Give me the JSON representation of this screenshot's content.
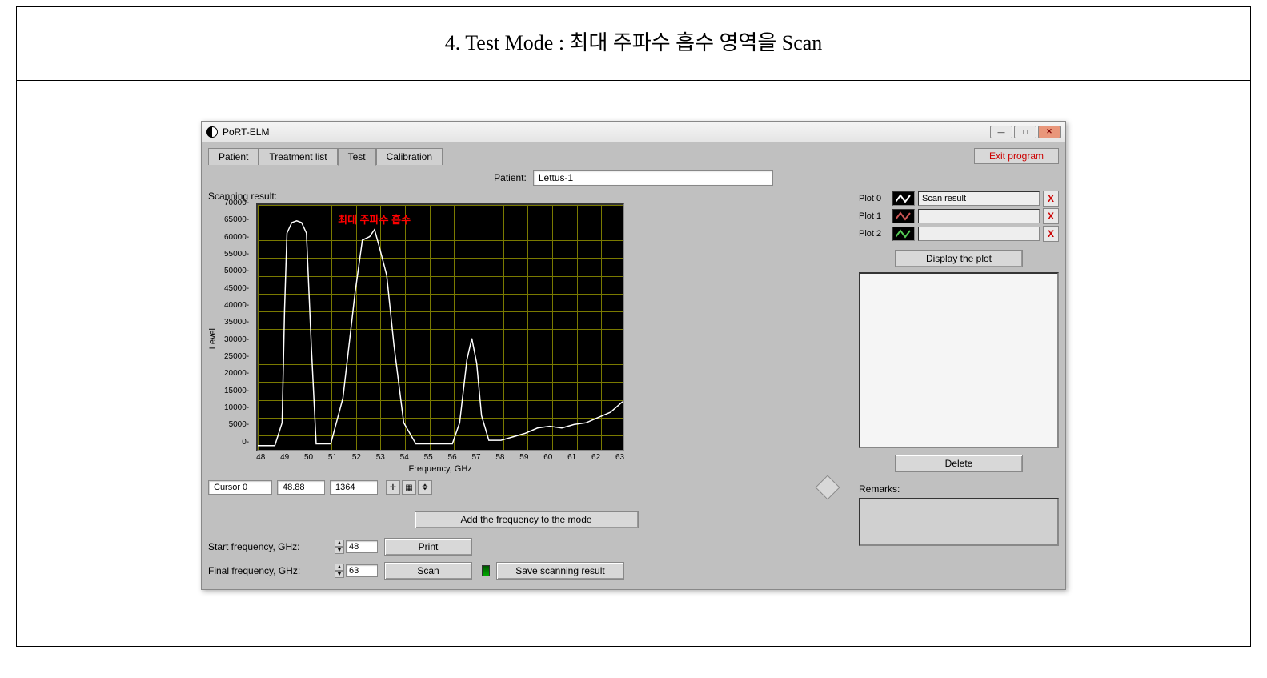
{
  "page_title": "4. Test Mode : 최대 주파수 흡수 영역을 Scan",
  "window": {
    "title": "PoRT-ELM",
    "min": "—",
    "max": "□",
    "close": "✕"
  },
  "tabs": [
    "Patient",
    "Treatment list",
    "Test",
    "Calibration"
  ],
  "active_tab": "Test",
  "exit_button": "Exit program",
  "patient_label": "Patient:",
  "patient_value": "Lettus-1",
  "scanning_label": "Scanning result:",
  "chart_annotation": "최대 주파수 흡수",
  "chart_data": {
    "type": "line",
    "title": "",
    "xlabel": "Frequency, GHz",
    "ylabel": "Level",
    "xlim": [
      48,
      63
    ],
    "ylim": [
      0,
      70000
    ],
    "x_ticks": [
      48,
      49,
      50,
      51,
      52,
      53,
      54,
      55,
      56,
      57,
      58,
      59,
      60,
      61,
      62,
      63
    ],
    "y_ticks": [
      0,
      5000,
      10000,
      15000,
      20000,
      25000,
      30000,
      35000,
      40000,
      45000,
      50000,
      55000,
      60000,
      65000,
      70000
    ],
    "series": [
      {
        "name": "Scan result",
        "color": "#ffffff",
        "x": [
          48,
          48.7,
          49,
          49.1,
          49.2,
          49.4,
          49.6,
          49.8,
          50,
          50.2,
          50.4,
          51,
          51.5,
          52,
          52.3,
          52.6,
          52.8,
          53,
          53.3,
          53.6,
          54,
          54.5,
          55,
          55.5,
          56,
          56.3,
          56.6,
          56.8,
          57,
          57.2,
          57.5,
          58,
          58.5,
          59,
          59.5,
          60,
          60.5,
          61,
          61.5,
          62,
          62.5,
          63
        ],
        "y": [
          1500,
          1500,
          8000,
          40000,
          62000,
          65000,
          65500,
          65000,
          62000,
          30000,
          2000,
          2000,
          15000,
          45000,
          60000,
          61000,
          63000,
          58000,
          50000,
          30000,
          8000,
          2000,
          2000,
          2000,
          2000,
          8000,
          26000,
          32000,
          25000,
          10000,
          3000,
          3000,
          4000,
          5000,
          6500,
          7000,
          6500,
          7500,
          8000,
          9500,
          11000,
          14000
        ]
      }
    ]
  },
  "cursor": {
    "name": "Cursor 0",
    "x": "48.88",
    "y": "1364"
  },
  "add_freq_button": "Add the frequency to the mode",
  "start_freq_label": "Start frequency, GHz:",
  "start_freq_value": "48",
  "final_freq_label": "Final frequency, GHz:",
  "final_freq_value": "63",
  "print_button": "Print",
  "scan_button": "Scan",
  "save_button": "Save scanning result",
  "plots": [
    {
      "label": "Plot 0",
      "value": "Scan result",
      "color": "#ffffff"
    },
    {
      "label": "Plot 1",
      "value": "",
      "color": "#cc5555"
    },
    {
      "label": "Plot 2",
      "value": "",
      "color": "#55cc55"
    }
  ],
  "display_plot_button": "Display the plot",
  "delete_button": "Delete",
  "remarks_label": "Remarks:"
}
